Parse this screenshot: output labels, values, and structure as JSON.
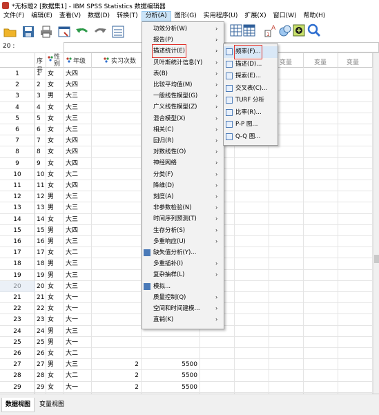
{
  "window": {
    "title": "*无标题2 [数据集1] - IBM SPSS Statistics 数据编辑器"
  },
  "menubar": {
    "items": [
      "文件(F)",
      "编辑(E)",
      "查看(V)",
      "数据(D)",
      "转换(T)",
      "分析(A)",
      "图形(G)",
      "实用程序(U)",
      "扩展(X)",
      "窗口(W)",
      "帮助(H)"
    ]
  },
  "toolbar": {
    "icons": [
      "open-icon",
      "save-icon",
      "print-icon",
      "dialog-recall-icon",
      "undo-icon",
      "redo-icon",
      "goto-case-icon",
      "grid-icon",
      "value-labels-icon",
      "sets-icon",
      "add-icon",
      "search-icon"
    ]
  },
  "cellref": {
    "label": "20 :"
  },
  "columns": {
    "seq": "序号",
    "gender": "性别",
    "grade": "年级",
    "practice": "实习次数",
    "var": "变量"
  },
  "rows": [
    {
      "n": "1",
      "seq": "1",
      "gender": "女",
      "grade": "大四"
    },
    {
      "n": "2",
      "seq": "2",
      "gender": "女",
      "grade": "大四"
    },
    {
      "n": "3",
      "seq": "3",
      "gender": "男",
      "grade": "大三"
    },
    {
      "n": "4",
      "seq": "4",
      "gender": "女",
      "grade": "大三"
    },
    {
      "n": "5",
      "seq": "5",
      "gender": "女",
      "grade": "大三"
    },
    {
      "n": "6",
      "seq": "6",
      "gender": "女",
      "grade": "大三"
    },
    {
      "n": "7",
      "seq": "7",
      "gender": "女",
      "grade": "大四"
    },
    {
      "n": "8",
      "seq": "8",
      "gender": "女",
      "grade": "大四"
    },
    {
      "n": "9",
      "seq": "9",
      "gender": "女",
      "grade": "大四"
    },
    {
      "n": "10",
      "seq": "10",
      "gender": "女",
      "grade": "大二"
    },
    {
      "n": "11",
      "seq": "11",
      "gender": "女",
      "grade": "大四"
    },
    {
      "n": "12",
      "seq": "12",
      "gender": "男",
      "grade": "大三"
    },
    {
      "n": "13",
      "seq": "13",
      "gender": "男",
      "grade": "大三"
    },
    {
      "n": "14",
      "seq": "14",
      "gender": "女",
      "grade": "大三"
    },
    {
      "n": "15",
      "seq": "15",
      "gender": "男",
      "grade": "大四"
    },
    {
      "n": "16",
      "seq": "16",
      "gender": "男",
      "grade": "大三"
    },
    {
      "n": "17",
      "seq": "17",
      "gender": "女",
      "grade": "大二"
    },
    {
      "n": "18",
      "seq": "18",
      "gender": "男",
      "grade": "大三"
    },
    {
      "n": "19",
      "seq": "19",
      "gender": "男",
      "grade": "大三"
    },
    {
      "n": "20",
      "seq": "20",
      "gender": "女",
      "grade": "大三"
    },
    {
      "n": "21",
      "seq": "21",
      "gender": "女",
      "grade": "大一"
    },
    {
      "n": "22",
      "seq": "22",
      "gender": "女",
      "grade": "大一"
    },
    {
      "n": "23",
      "seq": "23",
      "gender": "女",
      "grade": "大一"
    },
    {
      "n": "24",
      "seq": "24",
      "gender": "男",
      "grade": "大三"
    },
    {
      "n": "25",
      "seq": "25",
      "gender": "男",
      "grade": "大一"
    },
    {
      "n": "26",
      "seq": "26",
      "gender": "女",
      "grade": "大二"
    },
    {
      "n": "27",
      "seq": "27",
      "gender": "男",
      "grade": "大三",
      "practice": "2",
      "amount": "5500"
    },
    {
      "n": "28",
      "seq": "28",
      "gender": "女",
      "grade": "大二",
      "practice": "2",
      "amount": "5500"
    },
    {
      "n": "29",
      "seq": "29",
      "gender": "女",
      "grade": "大一",
      "practice": "2",
      "amount": "5500"
    },
    {
      "n": "30",
      "seq": "30",
      "gender": "女",
      "grade": "大三",
      "practice": "2",
      "amount": "5500"
    },
    {
      "n": "31",
      "seq": "31",
      "gender": "女",
      "grade": "大一",
      "practice": "1",
      "amount": "5500"
    },
    {
      "n": "32",
      "seq": "32",
      "gender": "女",
      "grade": "大二",
      "practice": "2",
      "amount": "5500"
    }
  ],
  "analyze_menu": {
    "items": [
      {
        "label": "功效分析(W)",
        "arrow": "›"
      },
      {
        "label": "报告(P)",
        "arrow": "›"
      },
      {
        "label": "描述统计(E)",
        "arrow": "›",
        "selected": true
      },
      {
        "label": "贝叶斯统计信息(Y)",
        "arrow": "›"
      },
      {
        "label": "表(B)",
        "arrow": "›"
      },
      {
        "label": "比较平均值(M)",
        "arrow": "›"
      },
      {
        "label": "一般线性模型(G)",
        "arrow": "›"
      },
      {
        "label": "广义线性模型(Z)",
        "arrow": "›"
      },
      {
        "label": "混合模型(X)",
        "arrow": "›"
      },
      {
        "label": "相关(C)",
        "arrow": "›"
      },
      {
        "label": "回归(R)",
        "arrow": "›"
      },
      {
        "label": "对数线性(O)",
        "arrow": "›"
      },
      {
        "label": "神经网络",
        "arrow": "›"
      },
      {
        "label": "分类(F)",
        "arrow": "›"
      },
      {
        "label": "降维(D)",
        "arrow": "›"
      },
      {
        "label": "刻度(A)",
        "arrow": "›"
      },
      {
        "label": "非参数检验(N)",
        "arrow": "›"
      },
      {
        "label": "时间序列预测(T)",
        "arrow": "›"
      },
      {
        "label": "生存分析(S)",
        "arrow": "›"
      },
      {
        "label": "多重响应(U)",
        "arrow": "›"
      },
      {
        "label": "缺失值分析(Y)...",
        "arrow": "",
        "icon": "missing-values-icon"
      },
      {
        "label": "多重插补(I)",
        "arrow": "›"
      },
      {
        "label": "复杂抽样(L)",
        "arrow": "›"
      },
      {
        "label": "模拟...",
        "arrow": "",
        "icon": "simulation-icon"
      },
      {
        "label": "质量控制(Q)",
        "arrow": "›"
      },
      {
        "label": "空间和时间建模...",
        "arrow": "›"
      },
      {
        "label": "直销(K)",
        "arrow": "›"
      }
    ]
  },
  "descriptive_submenu": {
    "items": [
      {
        "label": "频率(F)...",
        "icon": "frequencies-icon",
        "selected": true
      },
      {
        "label": "描述(D)...",
        "icon": "descriptives-icon"
      },
      {
        "label": "探索(E)...",
        "icon": "explore-icon"
      },
      {
        "label": "交叉表(C)...",
        "icon": "crosstabs-icon"
      },
      {
        "label": "TURF 分析",
        "icon": "turf-icon"
      },
      {
        "label": "比率(R)...",
        "icon": "ratio-icon"
      },
      {
        "label": "P-P 图...",
        "icon": "pp-plot-icon"
      },
      {
        "label": "Q-Q 图...",
        "icon": "qq-plot-icon"
      }
    ]
  },
  "bottom_tabs": {
    "data_view": "数据视图",
    "variable_view": "变量视图"
  }
}
